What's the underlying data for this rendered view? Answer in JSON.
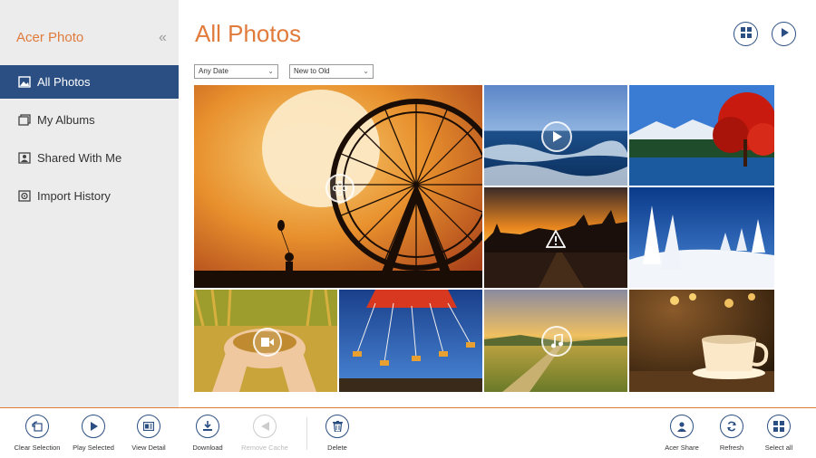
{
  "app": {
    "title": "Acer Photo",
    "collapse_glyph": "«"
  },
  "sidebar": {
    "items": [
      {
        "label": "All Photos",
        "icon": "photos-icon",
        "active": true
      },
      {
        "label": "My Albums",
        "icon": "albums-icon",
        "active": false
      },
      {
        "label": "Shared With Me",
        "icon": "shared-icon",
        "active": false
      },
      {
        "label": "Import History",
        "icon": "import-icon",
        "active": false
      }
    ]
  },
  "main": {
    "title": "All Photos",
    "filters": {
      "date": "Any Date",
      "sort": "New to Old"
    },
    "photos": [
      {
        "subject": "moon-ferris-wheel",
        "overlay": "selection-icon"
      },
      {
        "subject": "ocean-waves",
        "overlay": "play-icon"
      },
      {
        "subject": "red-tree-lake",
        "overlay": ""
      },
      {
        "subject": "sunset-city",
        "overlay": "warning-icon"
      },
      {
        "subject": "snowy-trees",
        "overlay": ""
      },
      {
        "subject": "hands-grain",
        "overlay": "video-icon"
      },
      {
        "subject": "swing-ride",
        "overlay": ""
      },
      {
        "subject": "field-sunset",
        "overlay": "music-icon"
      },
      {
        "subject": "coffee-cup",
        "overlay": ""
      }
    ]
  },
  "toolbar": {
    "clear_selection": "Clear Selection",
    "play_selected": "Play Selected",
    "view_detail": "View Detail",
    "download": "Download",
    "remove_cache": "Remove Cache",
    "delete": "Delete",
    "acer_share": "Acer Share",
    "refresh": "Refresh",
    "select_all": "Select all"
  },
  "colors": {
    "accent": "#e07b3c",
    "nav_active": "#2b4f83",
    "sidebar_bg": "#ececec"
  }
}
